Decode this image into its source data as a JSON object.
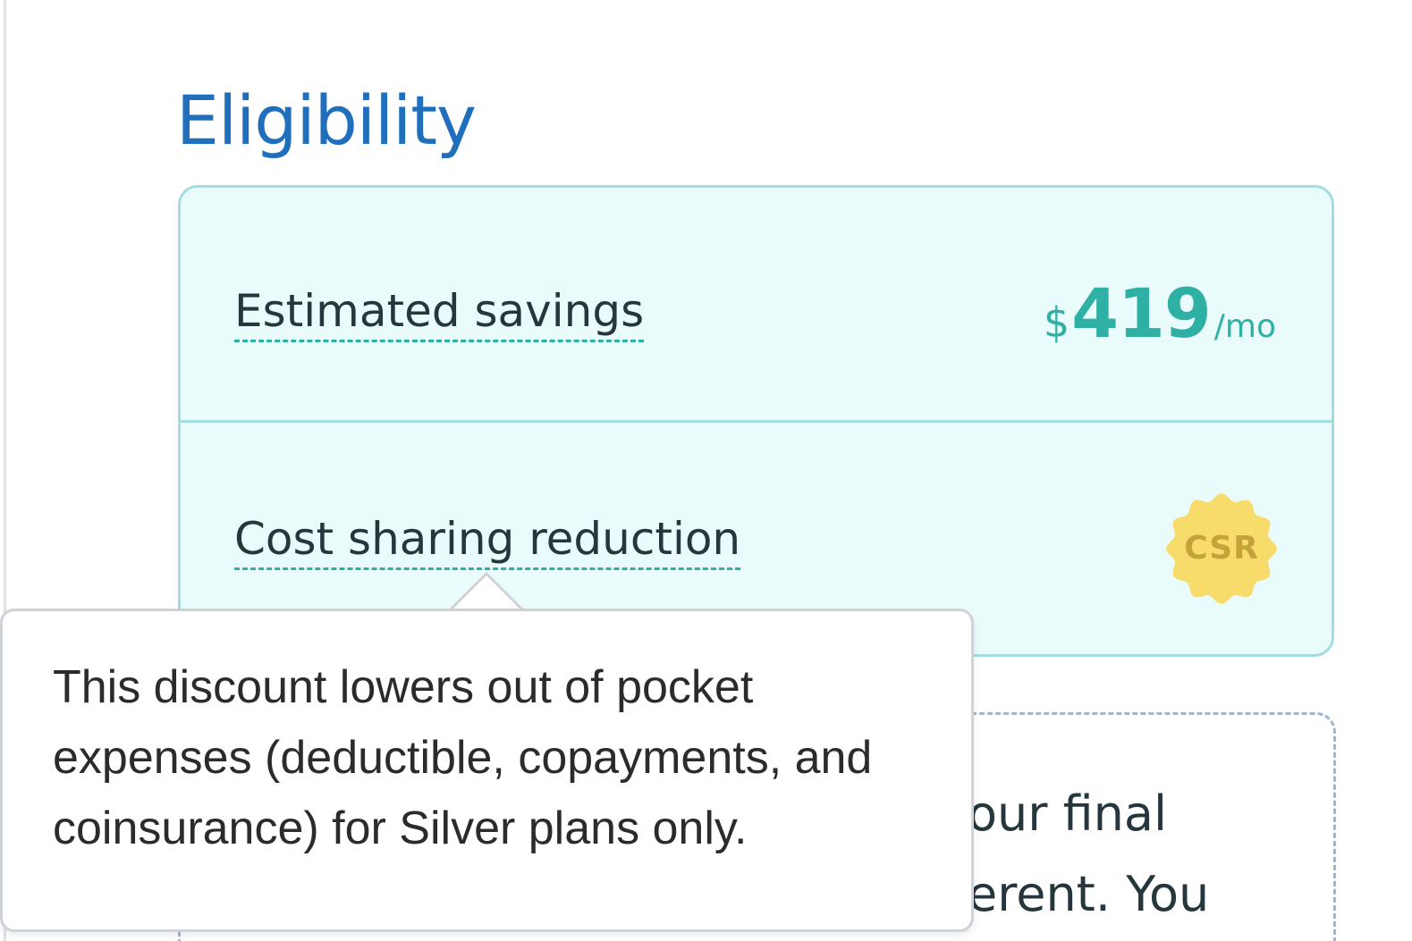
{
  "section": {
    "title": "Eligibility"
  },
  "eligibility_card": {
    "savings": {
      "label": "Estimated savings",
      "currency_symbol": "$",
      "amount": "419",
      "unit": "/mo"
    },
    "csr": {
      "label": "Cost sharing reduction",
      "badge": "CSR",
      "badge_color": "#f8dc6b"
    }
  },
  "tooltip": {
    "text": "This discount lowers out of pocket expenses (deductible, copayments, and coinsurance) for Silver plans only."
  },
  "notice": {
    "line1": "our final",
    "line2": "erent. You"
  },
  "colors": {
    "title": "#1f6fbd",
    "accent": "#2fb0a4",
    "card_background": "#e9fcfb",
    "card_border": "#a2dde0"
  }
}
